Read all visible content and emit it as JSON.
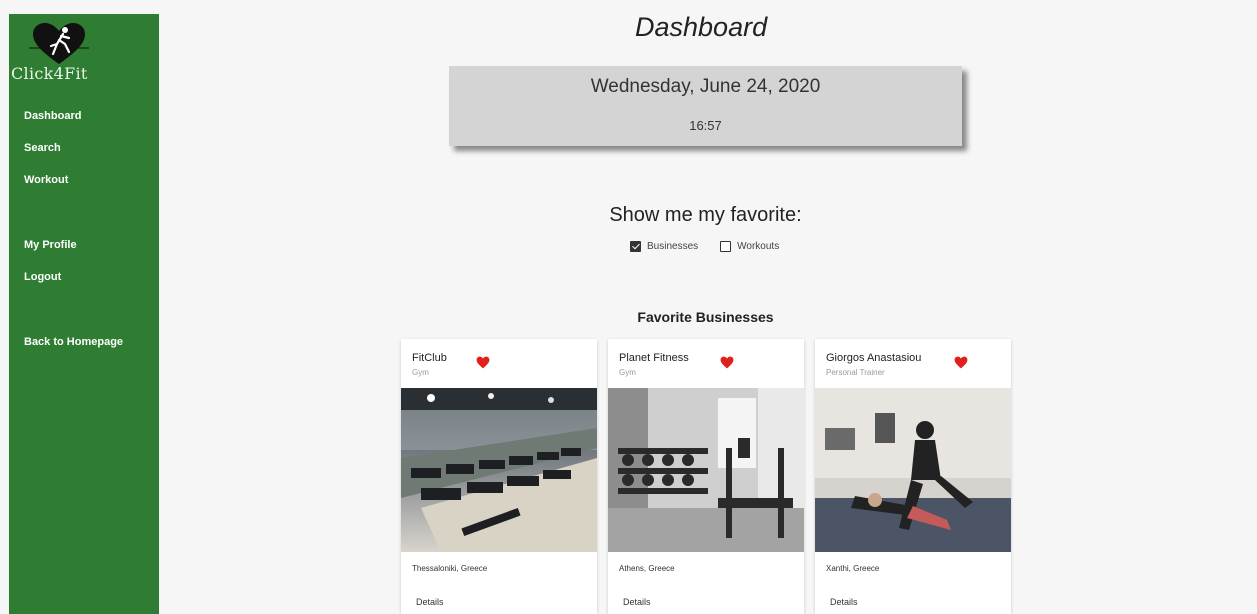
{
  "app": {
    "name": "Click4Fit"
  },
  "sidebar": {
    "items": [
      {
        "label": "Dashboard"
      },
      {
        "label": "Search"
      },
      {
        "label": "Workout"
      },
      {
        "label": "My Profile"
      },
      {
        "label": "Logout"
      },
      {
        "label": "Back to Homepage"
      }
    ]
  },
  "main": {
    "title": "Dashboard",
    "date": "Wednesday, June 24, 2020",
    "time": "16:57",
    "favorite_prompt": "Show me my favorite:",
    "filters": [
      {
        "label": "Businesses",
        "checked": true
      },
      {
        "label": "Workouts",
        "checked": false
      }
    ],
    "section_title": "Favorite Businesses",
    "cards": [
      {
        "name": "FitClub",
        "type": "Gym",
        "location": "Thessaloniki, Greece",
        "action": "Details",
        "favorite": true
      },
      {
        "name": "Planet Fitness",
        "type": "Gym",
        "location": "Athens, Greece",
        "action": "Details",
        "favorite": true
      },
      {
        "name": "Giorgos Anastasiou",
        "type": "Personal Trainer",
        "location": "Xanthi, Greece",
        "action": "Details",
        "favorite": true
      }
    ]
  },
  "colors": {
    "sidebar": "#2e7d32",
    "heart": "#e0201b",
    "date_card": "#d4d4d4"
  },
  "icons": {
    "logo": "heart-runner-icon",
    "favorite": "heart-icon",
    "checkbox": "checkbox-icon"
  }
}
